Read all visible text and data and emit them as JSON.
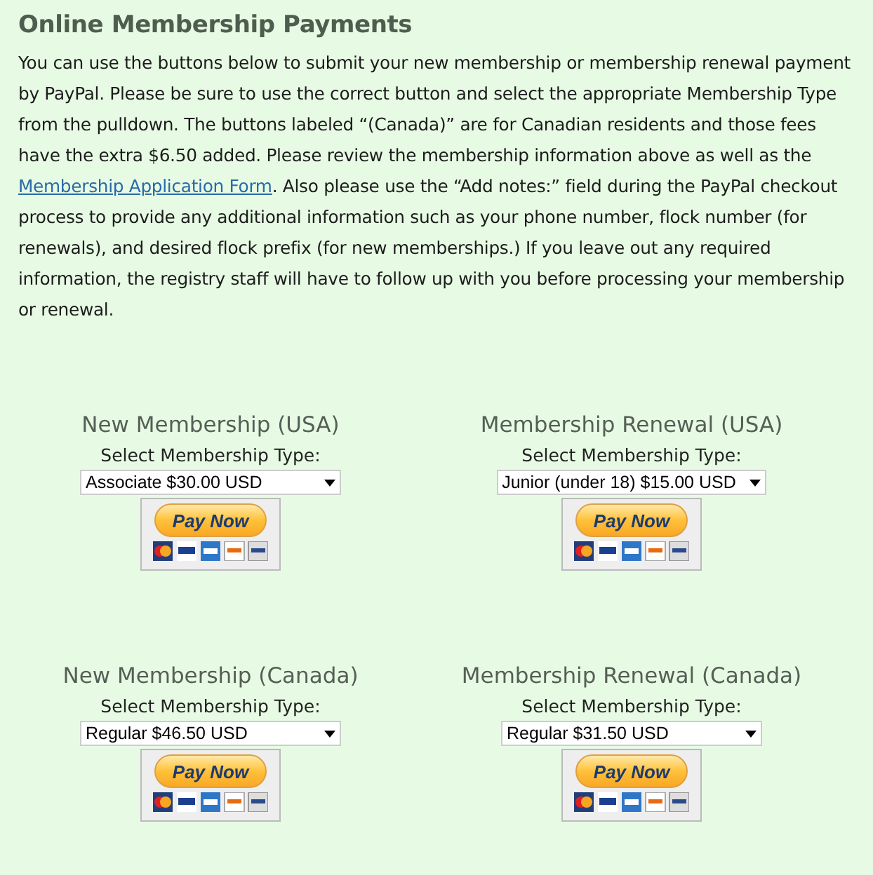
{
  "title": "Online Membership Payments",
  "intro": {
    "before": "You can use the buttons below to submit your new membership or membership renewal payment by PayPal. Please be sure to use the correct button and select the appropriate Membership Type from the pulldown. The buttons labeled “(Canada)” are for Canadian residents and those fees have the extra $6.50 added. Please review the membership information above as well as the ",
    "link": "Membership Application Form",
    "after": ". Also please use the “Add notes:” field during the PayPal checkout process to provide any additional information such as your phone number, flock number (for renewals), and desired flock prefix (for new memberships.) If you leave out any required information, the registry staff will have to follow up with you before processing your membership or renewal."
  },
  "payments": [
    {
      "heading": "New Membership (USA)",
      "select_label": "Select Membership Type:",
      "selected_option": "Associate $30.00 USD",
      "button": "Pay Now"
    },
    {
      "heading": "Membership Renewal (USA)",
      "select_label": "Select Membership Type:",
      "selected_option": "Junior (under 18) $15.00 USD",
      "button": "Pay Now"
    },
    {
      "heading": "New Membership (Canada)",
      "select_label": "Select Membership Type:",
      "selected_option": "Regular $46.50 USD",
      "button": "Pay Now"
    },
    {
      "heading": "Membership Renewal (Canada)",
      "select_label": "Select Membership Type:",
      "selected_option": "Regular $31.50 USD",
      "button": "Pay Now"
    }
  ]
}
